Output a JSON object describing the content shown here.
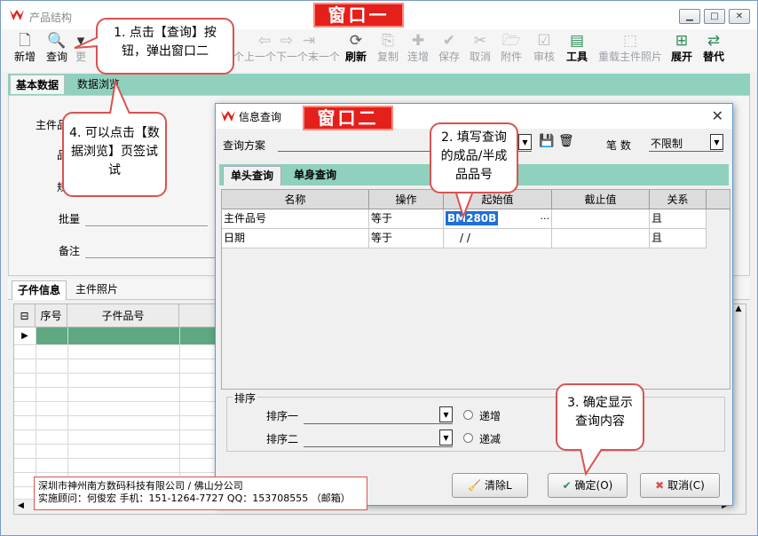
{
  "window1": {
    "title": "产品结构",
    "label": "窗口一",
    "toolbar": [
      {
        "label": "新增",
        "icon": "new-doc-icon"
      },
      {
        "label": "查询",
        "icon": "search-icon"
      },
      {
        "label": "更",
        "icon": "dropdown-icon"
      },
      {
        "label": "个上一个下一个末一个",
        "icon": "nav-arrows-icon"
      },
      {
        "label": "刷新",
        "icon": "refresh-icon"
      },
      {
        "label": "复制",
        "icon": "copy-icon"
      },
      {
        "label": "连增",
        "icon": "continuous-add-icon"
      },
      {
        "label": "保存",
        "icon": "save-icon"
      },
      {
        "label": "取消",
        "icon": "cancel-icon"
      },
      {
        "label": "附件",
        "icon": "attachment-icon"
      },
      {
        "label": "审核",
        "icon": "audit-icon"
      },
      {
        "label": "工具",
        "icon": "tools-icon"
      },
      {
        "label": "重载主件照片",
        "icon": "reload-photo-icon"
      },
      {
        "label": "展开",
        "icon": "expand-icon"
      },
      {
        "label": "替代",
        "icon": "replace-icon"
      }
    ],
    "tabs": [
      "基本数据",
      "数据浏览"
    ],
    "form": {
      "main_item": "主件品",
      "piece": "品",
      "spec": "规",
      "batch": "批量",
      "remark": "备注"
    },
    "sub_tabs": [
      "子件信息",
      "主件照片"
    ],
    "grid_headers": [
      "序号",
      "子件品号"
    ]
  },
  "dialog": {
    "title": "信息查询",
    "label": "窗口二",
    "scheme_label": "查询方案",
    "count_label": "笔  数",
    "count_value": "不限制",
    "tabs": [
      "单头查询",
      "单身查询"
    ],
    "headers": [
      "名称",
      "操作",
      "起始值",
      "截止值",
      "关系"
    ],
    "rows": [
      {
        "name": "主件品号",
        "op": "等于",
        "start": "BM280B",
        "end": "",
        "rel": "且"
      },
      {
        "name": "日期",
        "op": "等于",
        "start": "/ /",
        "end": "",
        "rel": "且"
      }
    ],
    "sort_legend": "排序",
    "sort1": "排序一",
    "sort2": "排序二",
    "asc": "递增",
    "desc": "递减",
    "btn_clear": "清除L",
    "btn_ok": "确定(O)",
    "btn_cancel": "取消(C)"
  },
  "callouts": {
    "c1": "1. 点击【查询】按钮，弹出窗口二",
    "c2": "2. 填写查询的成品/半成品品号",
    "c3": "3. 确定显示查询内容",
    "c4": "4. 可以点击【数据浏览】页签试试"
  },
  "info": {
    "line1": "深圳市神州南方数码科技有限公司 / 佛山分公司",
    "line2": "实施顾问：何俊宏  手机：151-1264-7727   QQ：153708555 （邮箱）"
  },
  "colors": {
    "accent_red": "#e4201c",
    "tab_green": "#8fd0be",
    "select_blue": "#1e6fd9"
  }
}
